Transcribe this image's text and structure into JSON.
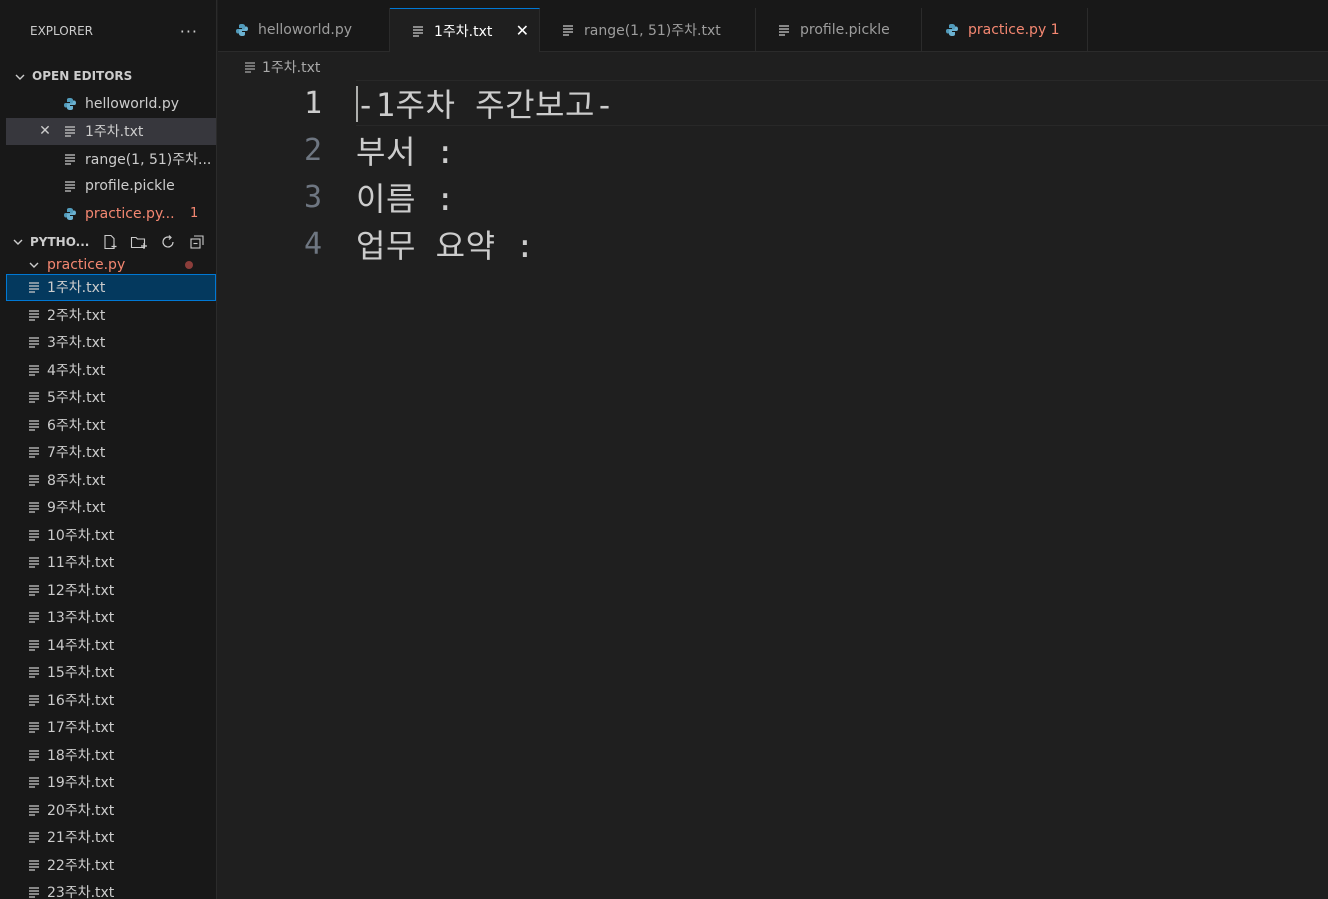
{
  "explorer": {
    "title": "EXPLORER",
    "more": "···"
  },
  "open_editors": {
    "title": "OPEN EDITORS",
    "items": [
      {
        "label": "helloworld.py",
        "icon": "python-icon"
      },
      {
        "label": "1주차.txt",
        "icon": "text-file-icon"
      },
      {
        "label": "range(1, 51)주차...",
        "icon": "text-file-icon"
      },
      {
        "label": "profile.pickle",
        "icon": "text-file-icon"
      },
      {
        "label": "practice.py...",
        "icon": "python-icon",
        "badge": "1"
      }
    ]
  },
  "workspace": {
    "title": "PYTHO...",
    "folder": "practice.py",
    "files": [
      "1주차.txt",
      "2주차.txt",
      "3주차.txt",
      "4주차.txt",
      "5주차.txt",
      "6주차.txt",
      "7주차.txt",
      "8주차.txt",
      "9주차.txt",
      "10주차.txt",
      "11주차.txt",
      "12주차.txt",
      "13주차.txt",
      "14주차.txt",
      "15주차.txt",
      "16주차.txt",
      "17주차.txt",
      "18주차.txt",
      "19주차.txt",
      "20주차.txt",
      "21주차.txt",
      "22주차.txt",
      "23주차.txt"
    ]
  },
  "tabs": [
    {
      "label": "helloworld.py",
      "icon": "python-icon"
    },
    {
      "label": "1주차.txt",
      "icon": "text-file-icon"
    },
    {
      "label": "range(1, 51)주차.txt",
      "icon": "text-file-icon"
    },
    {
      "label": "profile.pickle",
      "icon": "text-file-icon"
    },
    {
      "label": "practice.py 1",
      "icon": "python-icon"
    }
  ],
  "breadcrumb": "1주차.txt",
  "editor": {
    "lines": [
      {
        "num": "1",
        "text": "-1주차 주간보고-"
      },
      {
        "num": "2",
        "text": "부서 :"
      },
      {
        "num": "3",
        "text": "이름 :"
      },
      {
        "num": "4",
        "text": "업무 요약 :"
      }
    ]
  },
  "colors": {
    "accent": "#0078d4",
    "error": "#f48771",
    "python_icon": "#519aba"
  }
}
